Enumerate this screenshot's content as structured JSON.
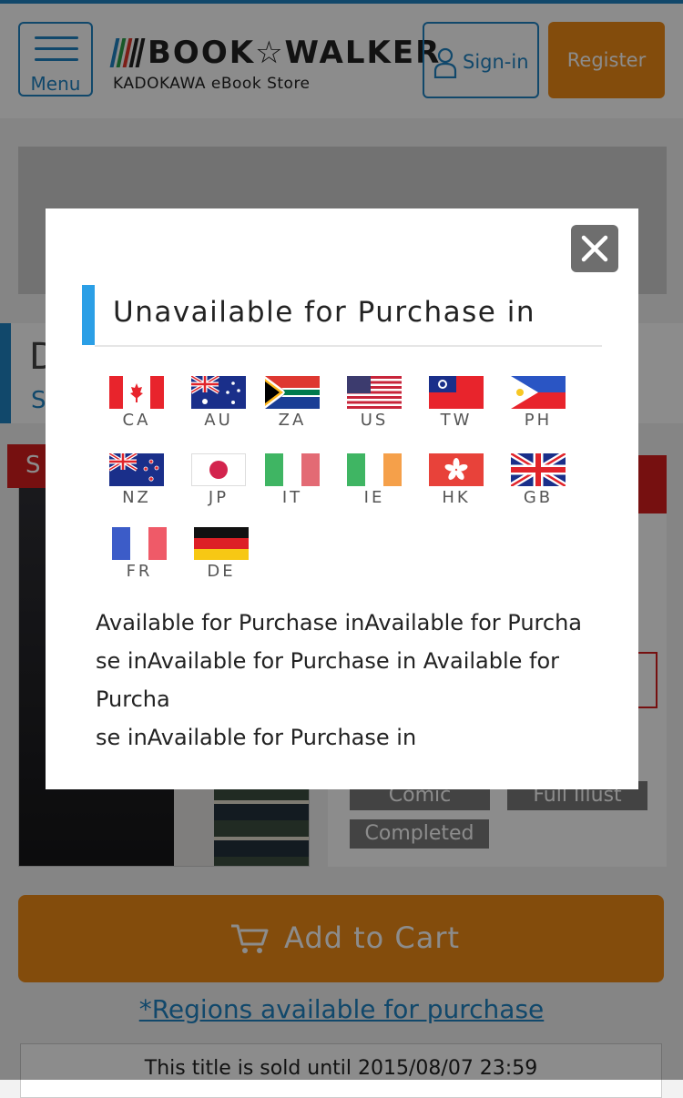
{
  "header": {
    "menu_label": "Menu",
    "logo_title": "BOOK☆WALKER",
    "logo_subtitle": "KADOKAWA eBook Store",
    "signin_label": "Sign-in",
    "register_label": "Register"
  },
  "background": {
    "title_initial": "D",
    "subtitle_initial": "S",
    "sale_initial": "S",
    "tags": [
      "Comic",
      "Full Illust",
      "Completed"
    ],
    "add_to_cart_label": "Add to Cart",
    "regions_link_label": "*Regions available for purchase",
    "sold_until_text": "This title is sold until 2015/08/07 23:59"
  },
  "modal": {
    "title": "Unavailable for Purchase in",
    "countries": [
      "CA",
      "AU",
      "ZA",
      "US",
      "TW",
      "PH",
      "NZ",
      "JP",
      "IT",
      "IE",
      "HK",
      "GB",
      "FR",
      "DE"
    ],
    "available_text": "Available for Purchase inAvailable for Purcha\nse inAvailable for Purchase in Available for\nPurcha\nse inAvailable for Purchase in"
  },
  "colors": {
    "brand_blue": "#1f83c4",
    "accent_orange": "#ef8a16",
    "modal_accent": "#2b9fe6",
    "sale_red": "#d81e1e",
    "overlay": "rgba(0,0,0,0.45)"
  },
  "icons": {
    "menu": "hamburger-icon",
    "signin": "person-icon",
    "cart": "cart-icon",
    "close": "close-icon"
  }
}
